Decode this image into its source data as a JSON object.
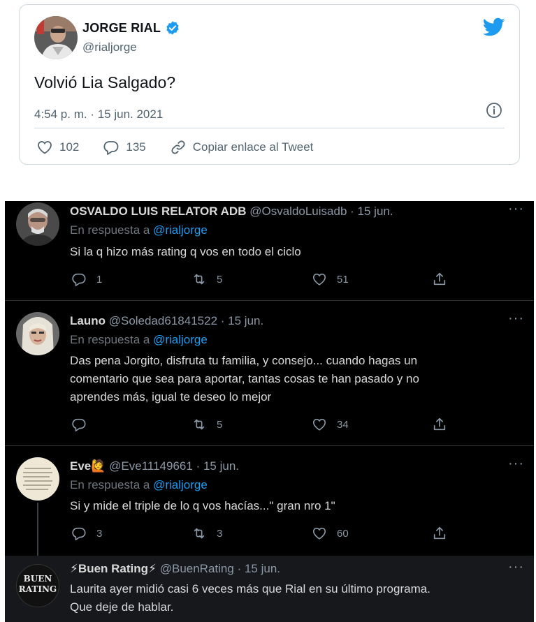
{
  "tweet": {
    "author_name": "JORGE RIAL",
    "author_handle": "@rialjorge",
    "verified": true,
    "text": "Volvió Lia Salgado?",
    "timestamp": "4:54 p. m. · 15 jun. 2021",
    "likes": "102",
    "replies": "135",
    "copy_link_label": "Copiar enlace al Tweet",
    "icons": [
      "twitter-bird-icon",
      "verified-badge-icon",
      "info-icon",
      "heart-icon",
      "reply-icon",
      "link-icon"
    ],
    "colors": {
      "brand": "#1d9bf0",
      "text": "#0f1419",
      "secondary": "#536471"
    }
  },
  "replies": [
    {
      "name": "OSVALDO LUIS RELATOR ADB",
      "handle": "@OsvaldoLuisadb",
      "date": "15 jun.",
      "in_reply_prefix": "En respuesta a",
      "in_reply_to": "@rialjorge",
      "text": "Si la q hizo más rating q vos en todo el ciclo",
      "reply_count": "1",
      "retweet_count": "5",
      "like_count": "51"
    },
    {
      "name": "Launo",
      "handle": "@Soledad61841522",
      "date": "15 jun.",
      "in_reply_prefix": "En respuesta a",
      "in_reply_to": "@rialjorge",
      "text_lines": [
        "Das pena Jorgito, disfruta tu familia, y  consejo... cuando hagas un",
        "comentario que sea para aportar, tantas cosas te han pasado y no",
        "aprendes más, igual te deseo lo mejor"
      ],
      "reply_count": "",
      "retweet_count": "5",
      "like_count": "34"
    },
    {
      "name": "Eve",
      "name_emoji": "🙋",
      "handle": "@Eve11149661",
      "date": "15 jun.",
      "in_reply_prefix": "En respuesta a",
      "in_reply_to": "@rialjorge",
      "text": "Si y mide el triple de lo q vos hacías...\" gran nro 1\"",
      "reply_count": "3",
      "retweet_count": "3",
      "like_count": "60"
    },
    {
      "name": "⚡Buen Rating⚡",
      "handle": "@BuenRating",
      "date": "15 jun.",
      "avatar_text": [
        "BUEN",
        "RATING"
      ],
      "text_lines": [
        "Laurita ayer midió casi 6 veces más que Rial en su último programa.",
        "Que deje de hablar."
      ]
    }
  ],
  "more_label": "···",
  "dot": "·"
}
